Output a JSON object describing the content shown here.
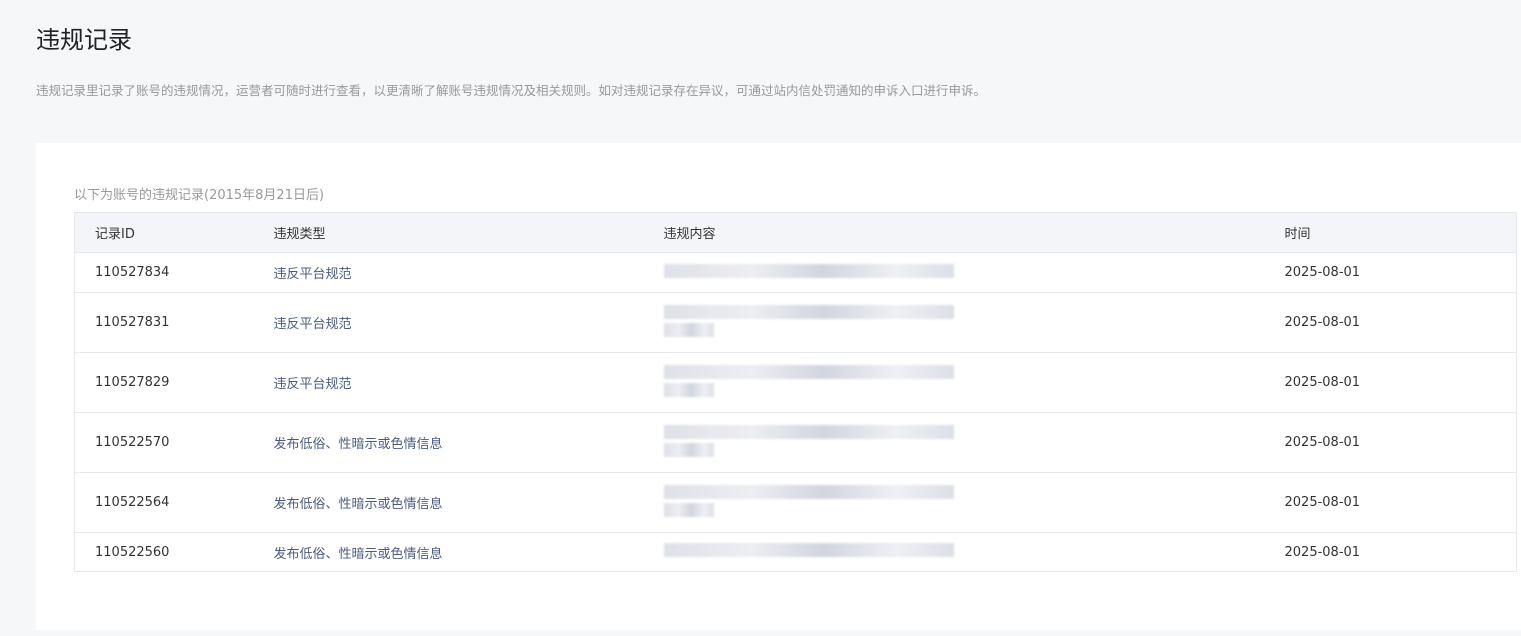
{
  "title": "违规记录",
  "description": "违规记录里记录了账号的违规情况，运营者可随时进行查看，以更清晰了解账号违规情况及相关规则。如对违规记录存在异议，可通过站内信处罚通知的申诉入口进行申诉。",
  "caption": "以下为账号的违规记录(2015年8月21日后)",
  "columns": [
    "记录ID",
    "违规类型",
    "违规内容",
    "时间"
  ],
  "rows": [
    {
      "id": "110527834",
      "type": "违反平台规范",
      "lines": 1,
      "time": "2025-08-01"
    },
    {
      "id": "110527831",
      "type": "违反平台规范",
      "lines": 2,
      "time": "2025-08-01"
    },
    {
      "id": "110527829",
      "type": "违反平台规范",
      "lines": 2,
      "time": "2025-08-01"
    },
    {
      "id": "110522570",
      "type": "发布低俗、性暗示或色情信息",
      "lines": 2,
      "time": "2025-08-01"
    },
    {
      "id": "110522564",
      "type": "发布低俗、性暗示或色情信息",
      "lines": 2,
      "time": "2025-08-01"
    },
    {
      "id": "110522560",
      "type": "发布低俗、性暗示或色情信息",
      "lines": 1,
      "time": "2025-08-01"
    }
  ]
}
